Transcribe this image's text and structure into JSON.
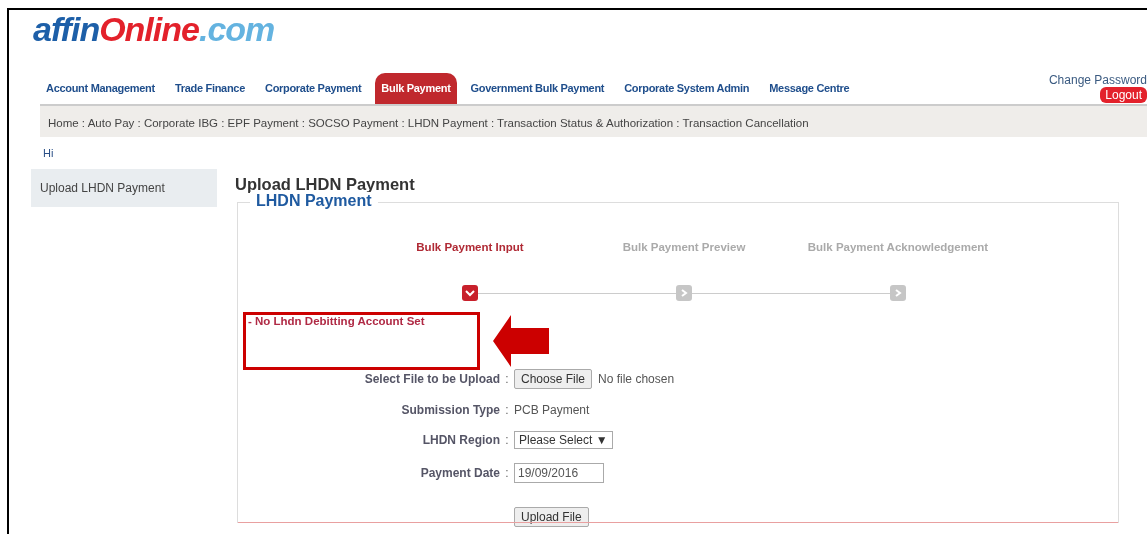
{
  "logo": [
    "affin",
    "Online",
    ".com"
  ],
  "nav": [
    {
      "label": "Account Management",
      "selected": false
    },
    {
      "label": "Trade Finance",
      "selected": false
    },
    {
      "label": "Corporate Payment",
      "selected": false
    },
    {
      "label": "Bulk Payment",
      "selected": true
    },
    {
      "label": "Government Bulk Payment",
      "selected": false
    },
    {
      "label": "Corporate System Admin",
      "selected": false
    },
    {
      "label": "Message Centre",
      "selected": false
    }
  ],
  "change_password": "Change Password",
  "logout": "Logout",
  "breadcrumb": "Home : Auto Pay : Corporate IBG : EPF Payment : SOCSO Payment : LHDN Payment : Transaction Status & Authorization : Transaction Cancellation",
  "greeting": "Hi",
  "sidebar": {
    "items": [
      {
        "label": "Upload LHDN Payment",
        "selected": true
      }
    ]
  },
  "page_title": "Upload LHDN Payment",
  "legend": "LHDN Payment",
  "steps": [
    {
      "label": "Bulk Payment Input",
      "selected": true
    },
    {
      "label": "Bulk Payment Preview",
      "selected": false
    },
    {
      "label": "Bulk Payment Acknowledgement",
      "selected": false
    }
  ],
  "error": "- No Lhdn Debitting Account Set",
  "form": [
    {
      "kind": "file",
      "label": "Select File to be Upload",
      "separator": ":",
      "button": "Choose File",
      "value": "No file chosen"
    },
    {
      "kind": "text",
      "label": "Submission Type",
      "separator": ":",
      "value": "PCB Payment"
    },
    {
      "kind": "select",
      "label": "LHDN Region",
      "separator": ":",
      "value": "Please Select",
      "arrow": "▼"
    },
    {
      "kind": "input",
      "label": "Payment Date",
      "separator": ":",
      "value": "19/09/2016"
    }
  ],
  "upload_button": "Upload File"
}
